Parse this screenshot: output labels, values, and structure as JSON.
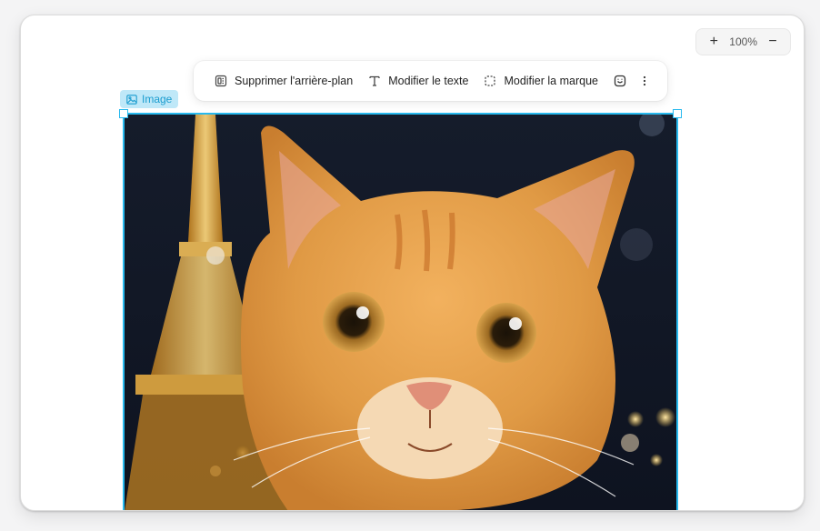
{
  "zoom": {
    "plus_label": "+",
    "value": "100%",
    "minus_label": "−"
  },
  "toolbar": {
    "remove_bg_label": "Supprimer l'arrière-plan",
    "edit_text_label": "Modifier le texte",
    "edit_brand_label": "Modifier la marque"
  },
  "selection": {
    "badge_label": "Image"
  },
  "colors": {
    "accent": "#27b9ee",
    "badge_bg": "#bfe8f8",
    "badge_text": "#1a9ccf"
  },
  "icons": [
    "remove-background-icon",
    "text-icon",
    "brand-dashed-square-icon",
    "smiley-square-icon",
    "more-vertical-icon",
    "image-icon",
    "plus-icon",
    "minus-icon"
  ]
}
